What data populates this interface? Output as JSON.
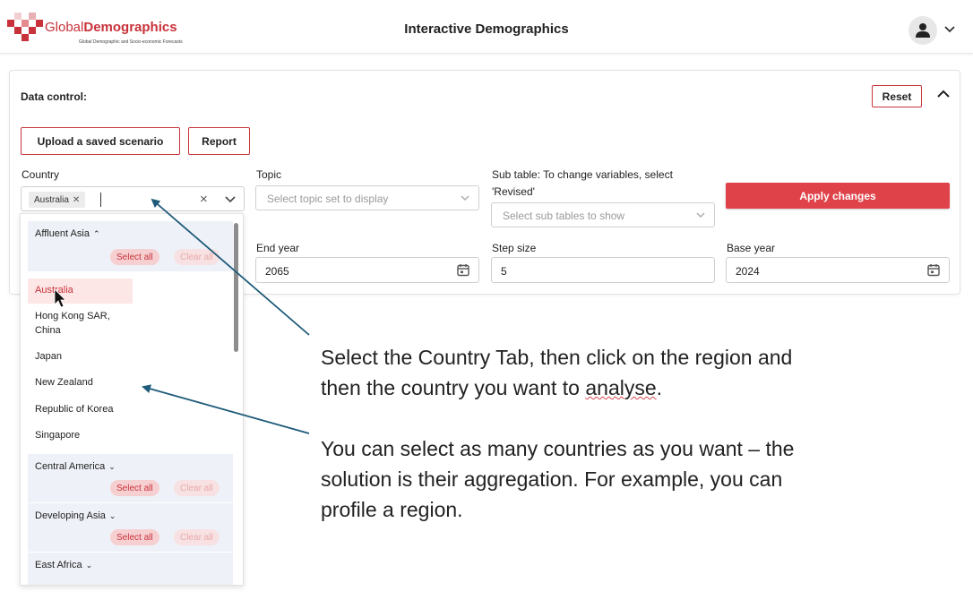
{
  "header": {
    "brand_part1": "Global",
    "brand_part2": "Demographics",
    "brand_tagline": "Global Demographic and Socio-economic Forecasts",
    "app_title": "Interactive Demographics"
  },
  "colors": {
    "accent": "#c8323a",
    "apply": "#e0424a",
    "group_bg": "#eef1f7"
  },
  "panel": {
    "title": "Data control:",
    "reset_label": "Reset",
    "upload_label": "Upload a saved scenario",
    "report_label": "Report",
    "country_label": "Country",
    "country_chip": "Australia",
    "topic_label": "Topic",
    "topic_placeholder": "Select topic set to display",
    "subtable_label_line1": "Sub table: To change variables, select",
    "subtable_label_line2": "'Revised'",
    "subtable_placeholder": "Select sub tables to show",
    "apply_label": "Apply changes",
    "end_year_label": "End year",
    "end_year_value": "2065",
    "step_size_label": "Step size",
    "step_size_value": "5",
    "base_year_label": "Base year",
    "base_year_value": "2024"
  },
  "dropdown": {
    "select_all": "Select all",
    "clear_all": "Clear all",
    "groups": [
      {
        "name": "Affluent Asia",
        "expanded": true
      },
      {
        "name": "Central America",
        "expanded": false
      },
      {
        "name": "Developing Asia",
        "expanded": false
      },
      {
        "name": "East Africa",
        "expanded": false
      }
    ],
    "options": [
      "Australia",
      "Hong Kong SAR,",
      "China",
      "Japan",
      "New Zealand",
      "Republic of Korea",
      "Singapore"
    ],
    "selected": "Australia"
  },
  "annotations": {
    "first_line1": "Select the Country Tab, then click on the region and",
    "first_line2a": "then the country you want to ",
    "first_line2b": "analyse",
    "first_line2c": ".",
    "second_line1": "You can select as many countries as you want – the",
    "second_line2": "solution is their aggregation. For example, you can",
    "second_line3": "profile a region."
  },
  "icons": [
    "logo-mark-icon",
    "user-icon",
    "chevron-down-icon",
    "chevron-up-icon",
    "calendar-icon",
    "close-icon",
    "mouse-cursor-icon"
  ]
}
